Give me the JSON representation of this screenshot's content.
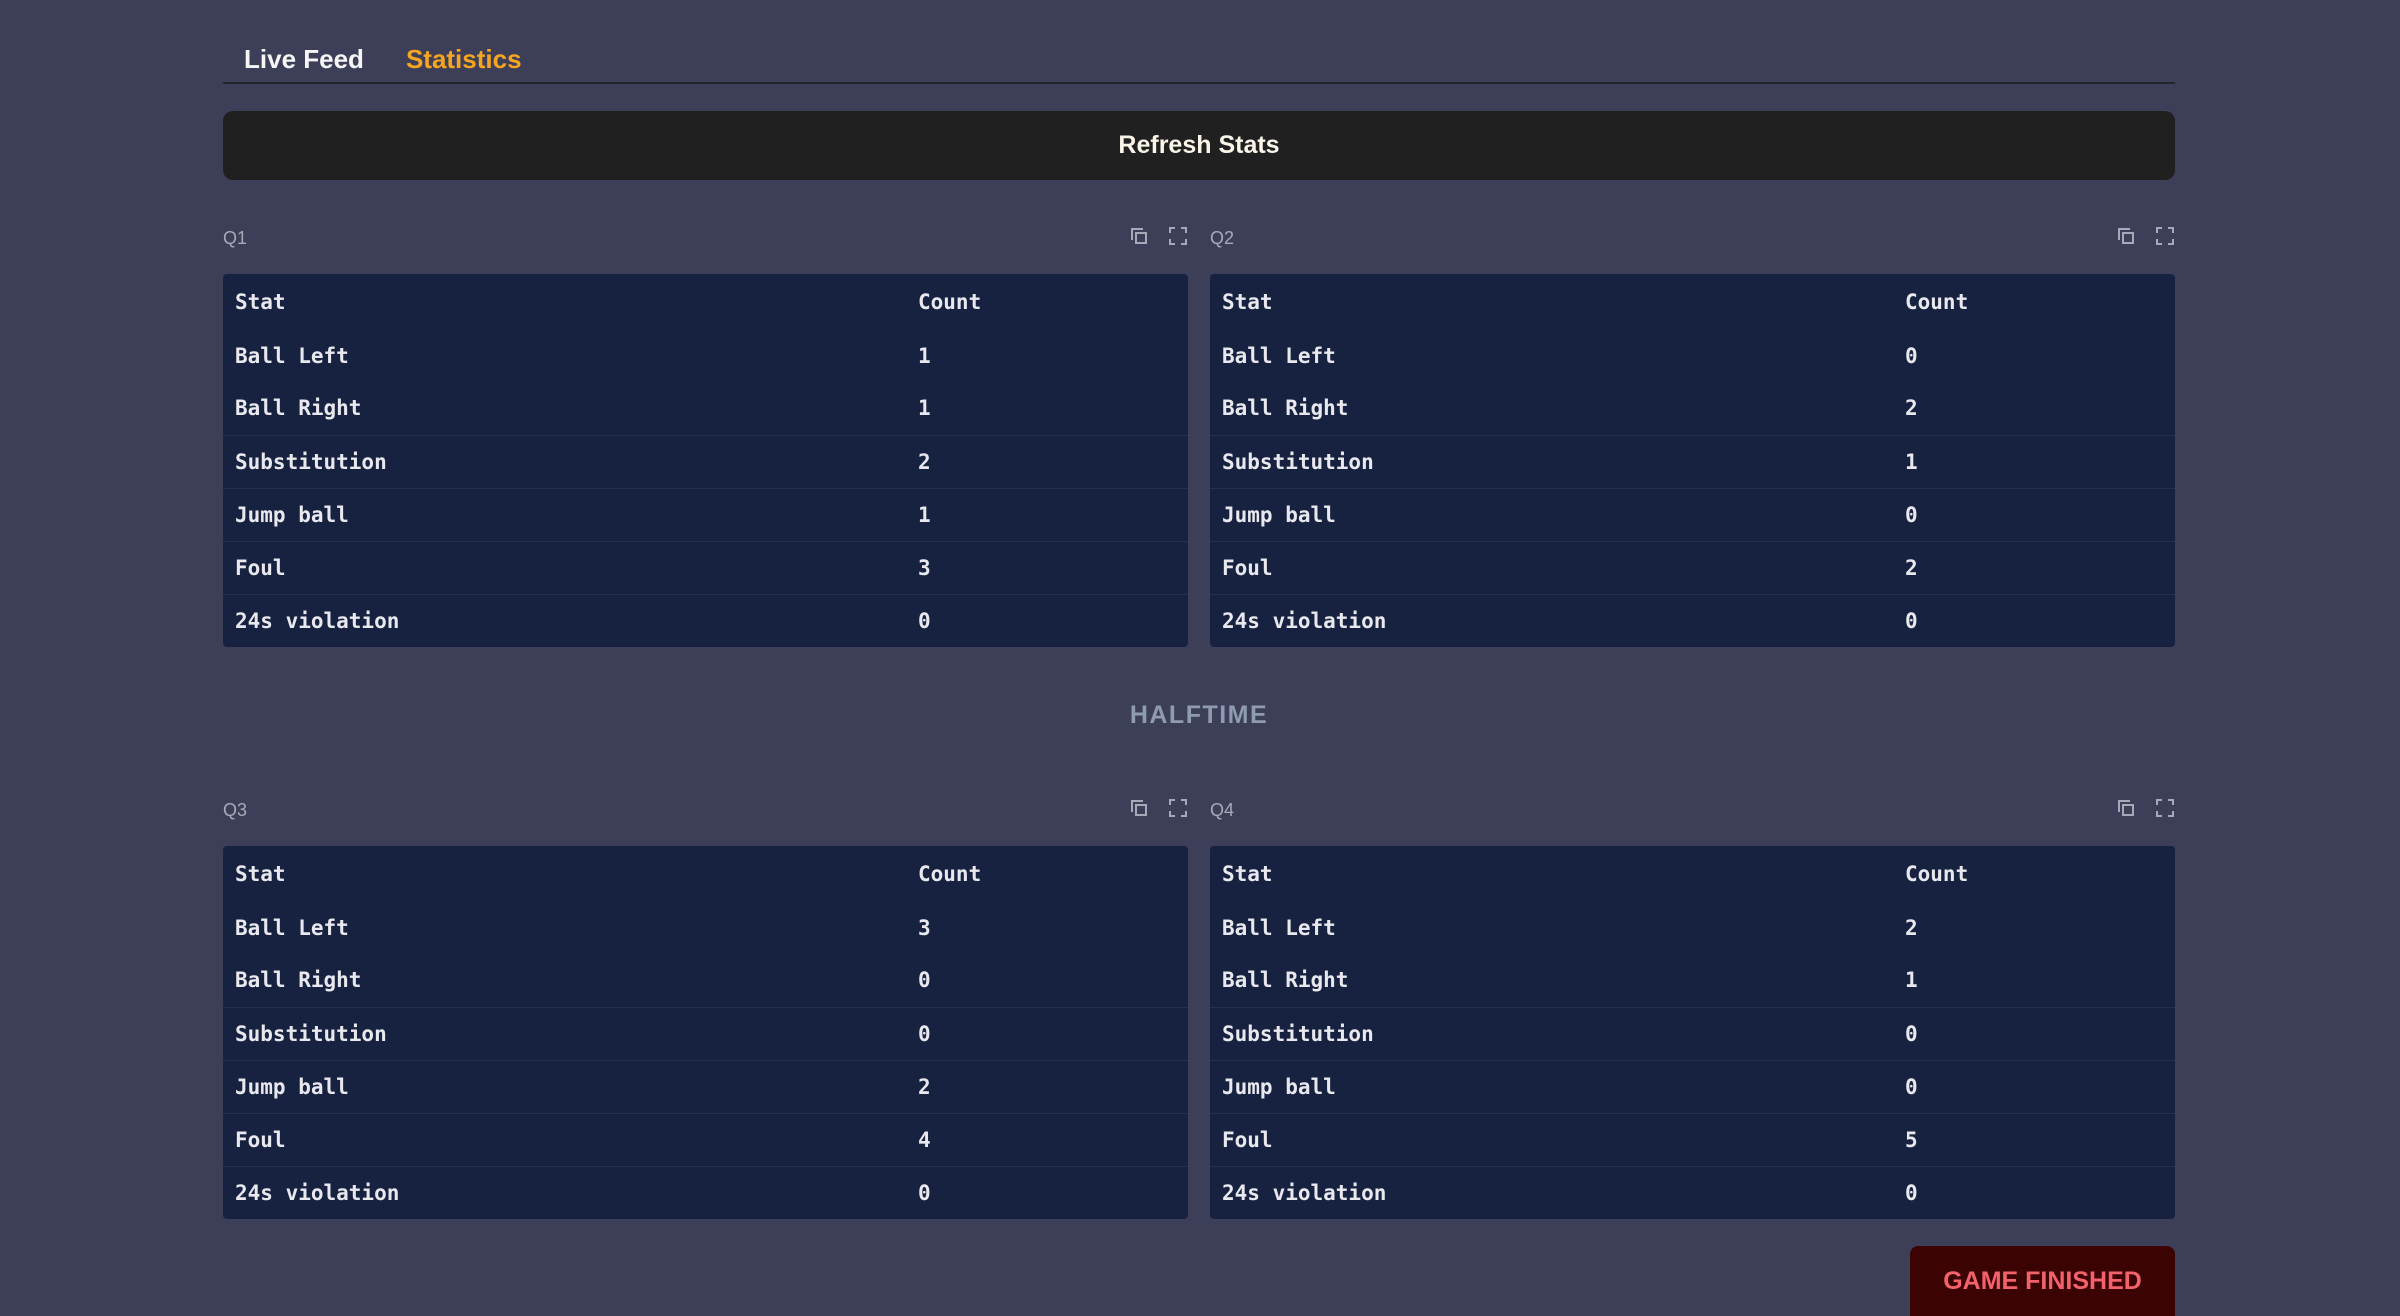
{
  "tabs": [
    {
      "label": "Live Feed"
    },
    {
      "label": "Statistics"
    }
  ],
  "refresh_label": "Refresh Stats",
  "table_header": {
    "stat": "Stat",
    "count": "Count"
  },
  "quarters": [
    {
      "label": "Q1",
      "rows": [
        {
          "stat": "Ball Left",
          "count": "1"
        },
        {
          "stat": "Ball Right",
          "count": "1"
        },
        {
          "stat": "Substitution",
          "count": "2"
        },
        {
          "stat": "Jump ball",
          "count": "1"
        },
        {
          "stat": "Foul",
          "count": "3"
        },
        {
          "stat": "24s violation",
          "count": "0"
        }
      ]
    },
    {
      "label": "Q2",
      "rows": [
        {
          "stat": "Ball Left",
          "count": "0"
        },
        {
          "stat": "Ball Right",
          "count": "2"
        },
        {
          "stat": "Substitution",
          "count": "1"
        },
        {
          "stat": "Jump ball",
          "count": "0"
        },
        {
          "stat": "Foul",
          "count": "2"
        },
        {
          "stat": "24s violation",
          "count": "0"
        }
      ]
    },
    {
      "label": "Q3",
      "rows": [
        {
          "stat": "Ball Left",
          "count": "3"
        },
        {
          "stat": "Ball Right",
          "count": "0"
        },
        {
          "stat": "Substitution",
          "count": "0"
        },
        {
          "stat": "Jump ball",
          "count": "2"
        },
        {
          "stat": "Foul",
          "count": "4"
        },
        {
          "stat": "24s violation",
          "count": "0"
        }
      ]
    },
    {
      "label": "Q4",
      "rows": [
        {
          "stat": "Ball Left",
          "count": "2"
        },
        {
          "stat": "Ball Right",
          "count": "1"
        },
        {
          "stat": "Substitution",
          "count": "0"
        },
        {
          "stat": "Jump ball",
          "count": "0"
        },
        {
          "stat": "Foul",
          "count": "5"
        },
        {
          "stat": "24s violation",
          "count": "0"
        }
      ]
    }
  ],
  "halftime_label": "HALFTIME",
  "game_finished_label": "GAME FINISHED",
  "colors": {
    "background": "#3d3f59",
    "active_tab": "#f5a51f",
    "table_bg": "#162240",
    "finished_bg": "#3c0304",
    "finished_text": "#f2626a"
  },
  "icons": [
    "copy-icon",
    "expand-icon"
  ]
}
